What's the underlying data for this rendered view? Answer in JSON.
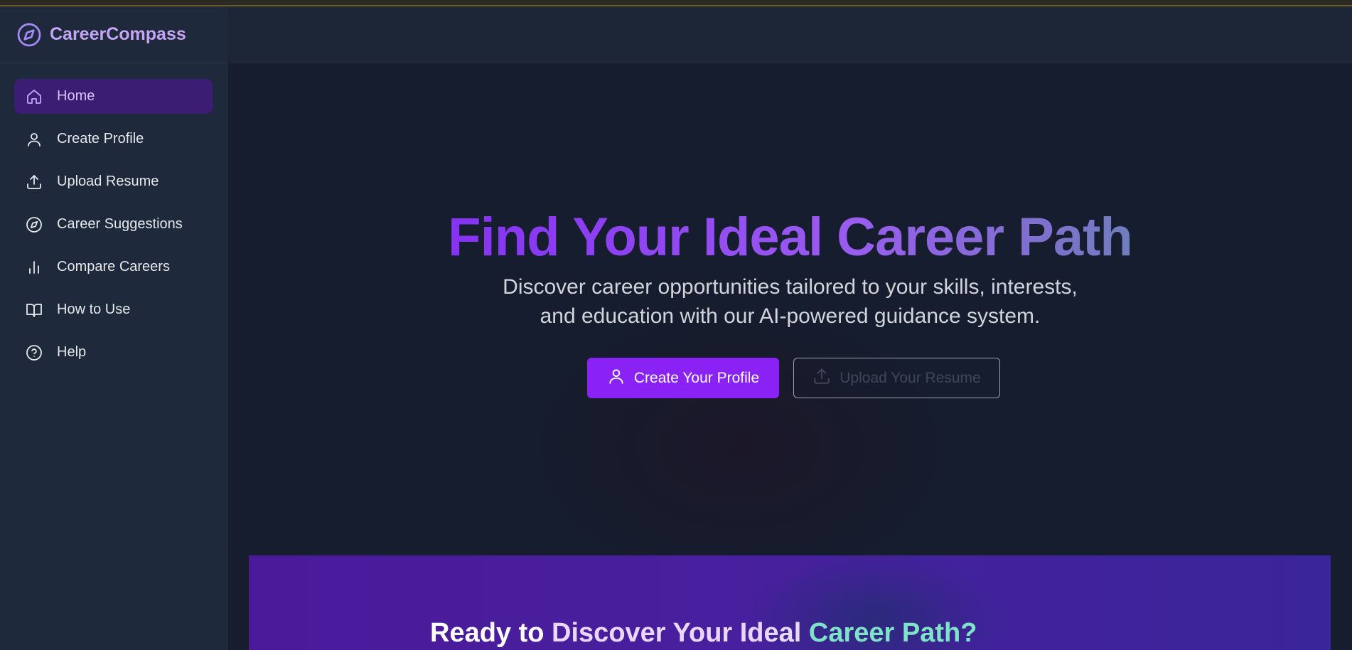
{
  "app": {
    "name": "CareerCompass"
  },
  "sidebar": {
    "items": [
      {
        "label": "Home",
        "icon": "home-icon",
        "active": true
      },
      {
        "label": "Create Profile",
        "icon": "user-icon"
      },
      {
        "label": "Upload Resume",
        "icon": "upload-icon"
      },
      {
        "label": "Career Suggestions",
        "icon": "compass-icon"
      },
      {
        "label": "Compare Careers",
        "icon": "bar-chart-icon"
      },
      {
        "label": "How to Use",
        "icon": "book-icon"
      },
      {
        "label": "Help",
        "icon": "help-circle-icon"
      }
    ]
  },
  "hero": {
    "title": "Find Your Ideal Career Path",
    "subtitle_line1": "Discover career opportunities tailored to your skills, interests,",
    "subtitle_line2": "and education with our AI-powered guidance system.",
    "primary_button": "Create Your Profile",
    "secondary_button": "Upload Your Resume"
  },
  "cta": {
    "title_part1": "Ready to ",
    "title_part2": "Discover Your Ideal ",
    "title_part3": "Career Path?"
  },
  "colors": {
    "accent": "#8b22f5",
    "sidebar_bg": "#1e293b",
    "main_bg": "#161d2e",
    "active_item_bg": "#3b1d73",
    "brand_text": "#c4a5f5",
    "teal_accent": "#7ee3c8"
  }
}
